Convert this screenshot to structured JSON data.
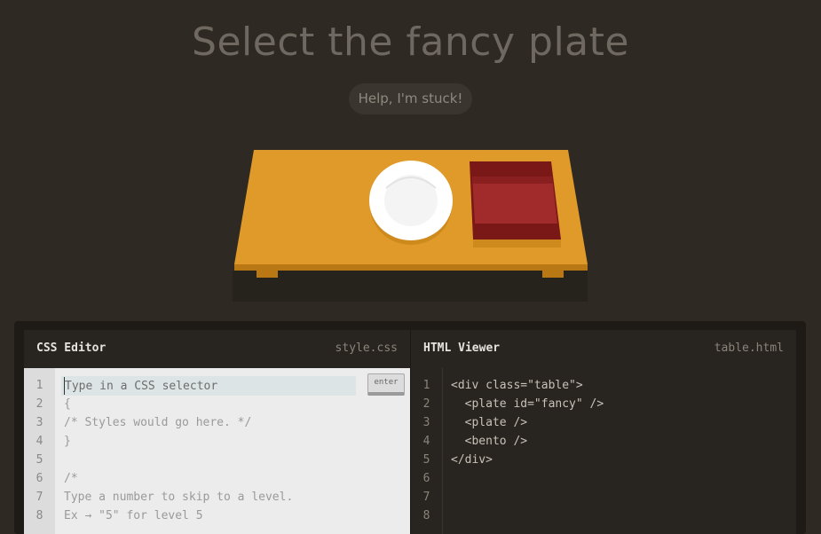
{
  "header": {
    "title": "Select the fancy plate",
    "help_label": "Help, I'm stuck!"
  },
  "css_editor": {
    "title": "CSS Editor",
    "filename": "style.css",
    "input_placeholder": "Type in a CSS selector",
    "enter_label": "enter",
    "line_numbers": [
      "1",
      "2",
      "3",
      "4",
      "5",
      "6",
      "7",
      "8"
    ],
    "lines": [
      "",
      "{",
      "/* Styles would go here. */",
      "}",
      "",
      "/*",
      "Type a number to skip to a level.",
      "Ex → \"5\" for level 5"
    ]
  },
  "html_viewer": {
    "title": "HTML Viewer",
    "filename": "table.html",
    "line_numbers": [
      "1",
      "2",
      "3",
      "4",
      "5",
      "6",
      "7",
      "8"
    ],
    "lines": [
      "<div class=\"table\">",
      "  <plate id=\"fancy\" />",
      "  <plate />",
      "  <bento />",
      "</div>",
      "",
      "",
      ""
    ]
  },
  "colors": {
    "table": "#e09a2a",
    "plate": "#ffffff",
    "bento": "#a12a2a",
    "background": "#2e2922"
  }
}
